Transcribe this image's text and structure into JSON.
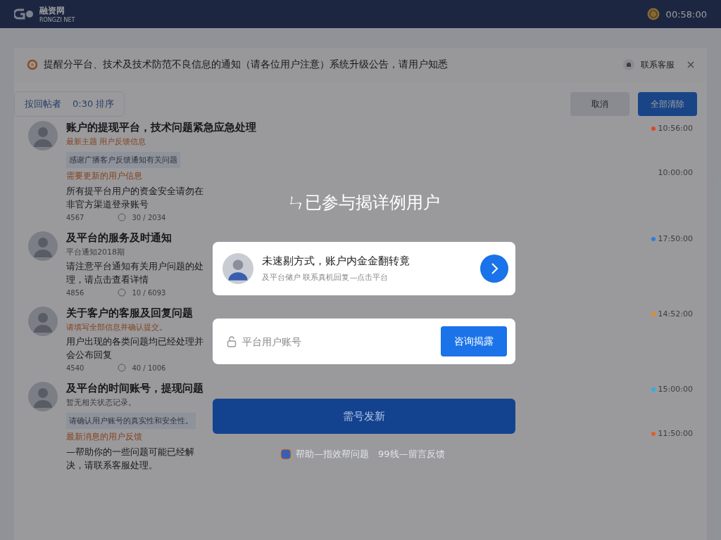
{
  "navbar": {
    "logo_text": "融资网",
    "logo_subtext": "RONGZI NET",
    "user_text": "00:58:00"
  },
  "notice": {
    "text": "提醒分平台、技术及技术防范不良信息的通知（请各位用户注意）系统升级公告，请用户知悉",
    "action": "联系客服"
  },
  "filter": {
    "label": "按回帖者",
    "value": "0:30 排序"
  },
  "buttons": [
    {
      "label": "取消",
      "kind": "secondary"
    },
    {
      "label": "全部清除",
      "kind": "primary"
    }
  ],
  "posts": [
    {
      "title": "账户的提现平台，技术问题紧急应急处理",
      "subtitle": "最新主题 用户反馈信息",
      "subtitle_highlighted": true,
      "quote": "感谢广播客户反馈通知有关问题",
      "highlight": "需要更新的用户信息",
      "body": "所有提平台用户的资金安全请勿在非官方渠道登录账号",
      "views": "4567",
      "replies": "30 / 2034",
      "times": [
        {
          "time": "10:56:00",
          "color": "#e0452b"
        },
        {
          "time": "10:00:00"
        }
      ]
    },
    {
      "title": "及平台的服务及时通知",
      "subtitle": "平台通知2018期",
      "subtitle_highlighted": false,
      "body": "请注意平台通知有关用户问题的处理，请点击查看详情",
      "views": "4856",
      "replies": "10 / 6093",
      "times": [
        {
          "time": "17:50:00",
          "color": "#2b7de0"
        }
      ]
    },
    {
      "title": "关于客户的客服及回复问题",
      "subtitle": "请填写全部信息并确认提交。",
      "subtitle_highlighted": true,
      "body": "用户出现的各类问题均已经处理并会公布回复",
      "views": "4540",
      "replies": "40 / 1006",
      "times": [
        {
          "time": "14:52:00",
          "color": "#e08a2b"
        }
      ]
    },
    {
      "title": "及平台的时间账号，提现问题",
      "subtitle": "暂无相关状态记录。",
      "subtitle_highlighted": false,
      "quote": "请确认用户账号的真实性和安全性。",
      "highlight": "最新消息的用户反馈",
      "body": "—帮助你的一些问题可能已经解决，请联系客服处理。",
      "times": [
        {
          "time": "15:00:00",
          "color": "#2bb0e0"
        },
        {
          "time": "11:50:00",
          "color": "#e0602b"
        }
      ]
    }
  ],
  "modal": {
    "title": "ㄣ已参与揭详例用户",
    "card": {
      "title": "未速剔方式，账户内金金翻转竟",
      "subtitle": "及平台储户 联系真机回复—点击平台"
    },
    "input": {
      "placeholder": "平台用户账号"
    },
    "input_button": "咨询揭露",
    "submit": "需号发新",
    "footer": "帮助—指效帮问题　99线—留言反馈"
  }
}
